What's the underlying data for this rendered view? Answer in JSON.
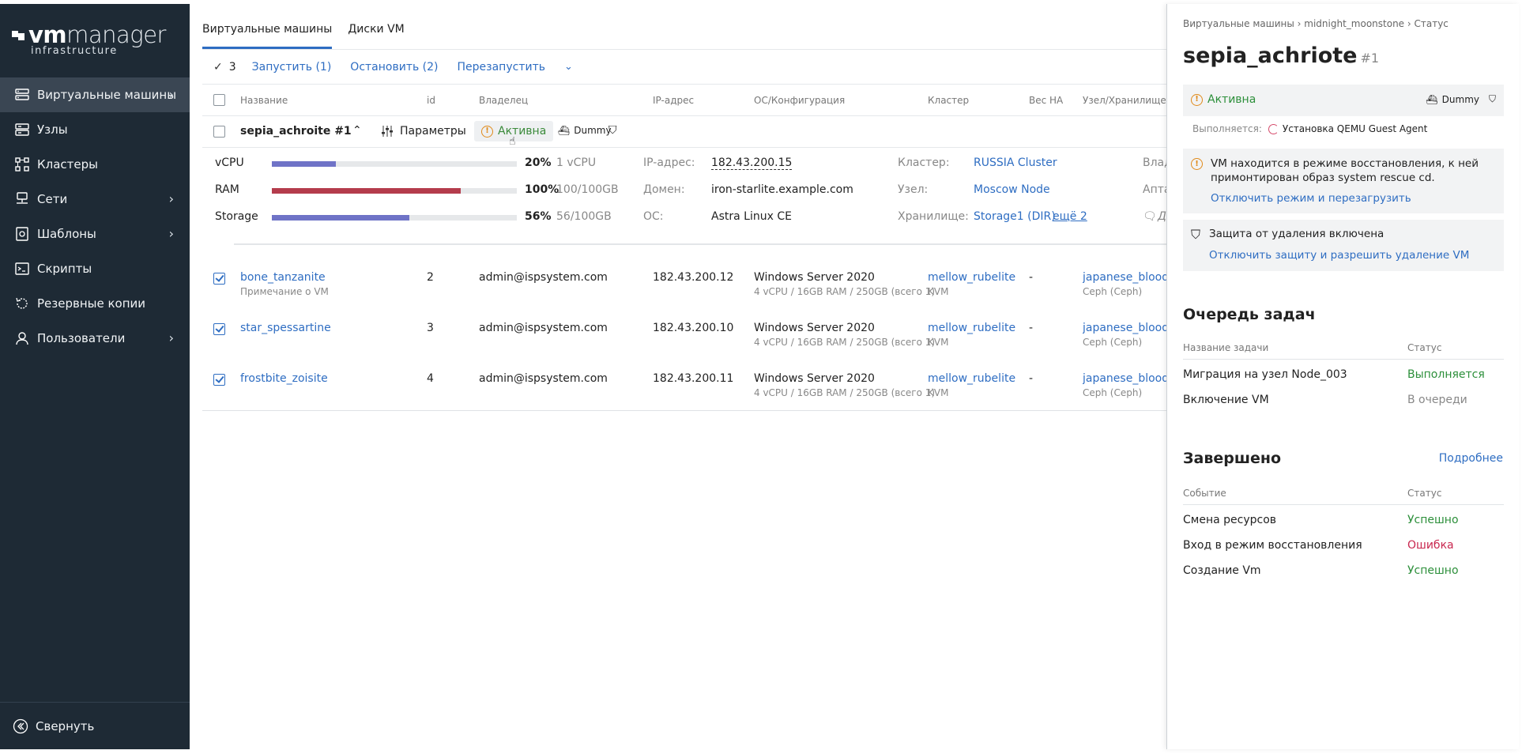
{
  "sidebar": {
    "logo_vm": "vm",
    "logo_manager": "manager",
    "logo_sub": "infrastructure",
    "items": [
      {
        "label": "Виртуальные машины",
        "icon": "server-icon"
      },
      {
        "label": "Узлы",
        "icon": "nodes-icon"
      },
      {
        "label": "Кластеры",
        "icon": "cluster-icon"
      },
      {
        "label": "Сети",
        "icon": "network-icon"
      },
      {
        "label": "Шаблоны",
        "icon": "template-icon"
      },
      {
        "label": "Скрипты",
        "icon": "script-icon"
      },
      {
        "label": "Резервные копии",
        "icon": "backup-icon"
      },
      {
        "label": "Пользователи",
        "icon": "user-icon"
      }
    ],
    "collapse_label": "Свернуть"
  },
  "tabs": [
    "Виртуальные машины",
    "Диски VM"
  ],
  "toolbar": {
    "selected_count": "3",
    "start": "Запустить (1)",
    "stop": "Остановить (2)",
    "restart": "Перезапустить"
  },
  "headers": {
    "name": "Название",
    "id": "id",
    "owner": "Владелец",
    "ip": "IP-адрес",
    "os": "ОС/Конфигурация",
    "cluster": "Кластер",
    "ha": "Вес HA",
    "node": "Узел/Хранилище"
  },
  "expanded": {
    "name": "sepia_achroite #1",
    "params": "Параметры",
    "status": "Активна",
    "dummy": "Dummy",
    "resources": [
      {
        "label": "vCPU",
        "pct": "20%",
        "value": "1 vCPU",
        "fill": 0.26,
        "color": "#6f73c7"
      },
      {
        "label": "RAM",
        "pct": "100%",
        "value": "100/100GB",
        "fill": 0.77,
        "color": "#b43c4c"
      },
      {
        "label": "Storage",
        "pct": "56%",
        "value": "56/100GB",
        "fill": 0.56,
        "color": "#6f73c7"
      }
    ],
    "info": [
      {
        "label": "IP-адрес:",
        "value": "182.43.200.15"
      },
      {
        "label": "Домен:",
        "value": "iron-starlite.example.com"
      },
      {
        "label": "ОС:",
        "value": "Astra Linux CE"
      }
    ],
    "info2": [
      {
        "label": "Кластер:",
        "value": "RUSSIA Cluster"
      },
      {
        "label": "Узел:",
        "value": "Moscow Node"
      },
      {
        "label": "Хранилище:",
        "value": "Storage1 (DIR)",
        "more": "ещё 2"
      }
    ],
    "cut": [
      "Влад",
      "Апта",
      "Д"
    ]
  },
  "rows": [
    {
      "name": "bone_tanzanite",
      "note": "Примечание о VM",
      "id": "2",
      "owner": "admin@ispsystem.com",
      "ip": "182.43.200.12",
      "os": "Windows Server 2020",
      "conf": "4 vCPU / 16GB RAM / 250GB (всего 1)",
      "cluster": "mellow_rubelite",
      "ctype": "KVM",
      "ha": "-",
      "node": "japanese_bloodstor",
      "storage": "Ceph (Ceph)"
    },
    {
      "name": "star_spessartine",
      "note": "",
      "id": "3",
      "owner": "admin@ispsystem.com",
      "ip": "182.43.200.10",
      "os": "Windows Server 2020",
      "conf": "4 vCPU / 16GB RAM / 250GB (всего 1)",
      "cluster": "mellow_rubelite",
      "ctype": "KVM",
      "ha": "-",
      "node": "japanese_bloodstor",
      "storage": "Ceph (Ceph)"
    },
    {
      "name": "frostbite_zoisite",
      "note": "",
      "id": "4",
      "owner": "admin@ispsystem.com",
      "ip": "182.43.200.11",
      "os": "Windows Server 2020",
      "conf": "4 vCPU / 16GB RAM / 250GB (всего 1)",
      "cluster": "mellow_rubelite",
      "ctype": "KVM",
      "ha": "-",
      "node": "japanese_bloodstor",
      "storage": "Ceph (Ceph)"
    }
  ],
  "panel": {
    "breadcrumb": "Виртуальные машины › midnight_moonstone › Статус",
    "title": "sepia_achriote",
    "title_num": "#1",
    "status": "Активна",
    "dummy": "Dummy",
    "running_label": "Выполняется:",
    "running_task": "Установка QEMU Guest Agent",
    "rescue_text": "VM находится в режиме восстановления, к ней примонтирован образ system rescue cd.",
    "rescue_link": "Отключить режим и перезагрузить",
    "protect_text": "Защита от удаления включена",
    "protect_link": "Отключить защиту и разрешить удаление VM",
    "queue_title": "Очередь задач",
    "queue_col1": "Название задачи",
    "queue_col2": "Статус",
    "queue": [
      {
        "name": "Миграция на узел Node_003",
        "status": "Выполняется",
        "kind": "ok"
      },
      {
        "name": "Включение VM",
        "status": "В очереди",
        "kind": "muted"
      }
    ],
    "done_title": "Завершено",
    "done_more": "Подробнее",
    "done_col1": "Событие",
    "done_col2": "Статус",
    "done": [
      {
        "name": "Смена ресурсов",
        "status": "Успешно",
        "kind": "ok"
      },
      {
        "name": "Вход в режим восстановления",
        "status": "Ошибка",
        "kind": "err"
      },
      {
        "name": "Создание Vm",
        "status": "Успешно",
        "kind": "ok"
      }
    ]
  }
}
